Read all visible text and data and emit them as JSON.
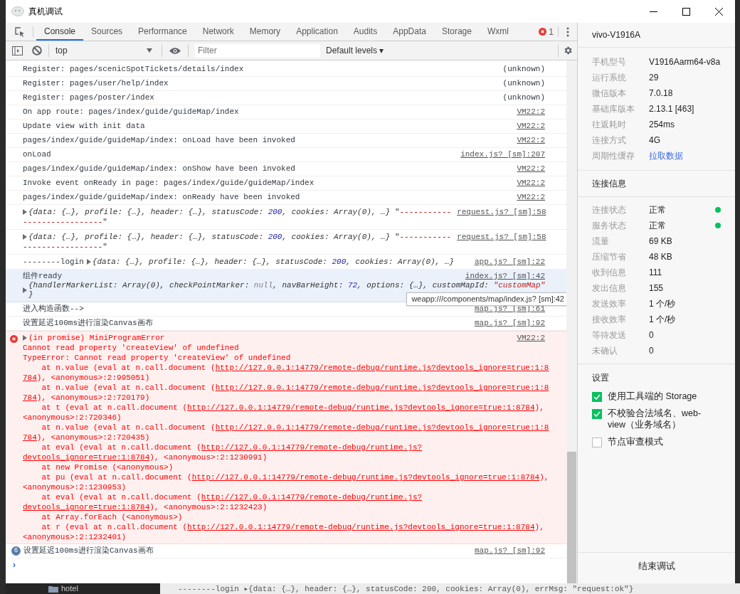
{
  "window": {
    "title": "真机调试"
  },
  "tabs": [
    {
      "label": "Console",
      "selected": true
    },
    {
      "label": "Sources",
      "selected": false
    },
    {
      "label": "Performance",
      "selected": false
    },
    {
      "label": "Network",
      "selected": false
    },
    {
      "label": "Memory",
      "selected": false
    },
    {
      "label": "Application",
      "selected": false
    },
    {
      "label": "Audits",
      "selected": false
    },
    {
      "label": "AppData",
      "selected": false
    },
    {
      "label": "Storage",
      "selected": false
    },
    {
      "label": "Wxml",
      "selected": false
    }
  ],
  "error_count": "1",
  "toolbar": {
    "context": "top",
    "filter_placeholder": "Filter",
    "levels": "Default levels",
    "levels_caret": "▾"
  },
  "console": [
    {
      "kind": "log",
      "text": "Register: pages/scenicSpotTickets/details/index",
      "source": "(unknown)",
      "source_link": false
    },
    {
      "kind": "log",
      "text": "Register: pages/user/help/index",
      "source": "(unknown)",
      "source_link": false
    },
    {
      "kind": "log",
      "text": "Register: pages/poster/index",
      "source": "(unknown)",
      "source_link": false
    },
    {
      "kind": "log",
      "text": "On app route: pages/index/guide/guideMap/index",
      "source": "VM22:2",
      "source_link": true
    },
    {
      "kind": "log",
      "text": "Update view with init data",
      "source": "VM22:2",
      "source_link": true
    },
    {
      "kind": "log",
      "text": "pages/index/guide/guideMap/index: onLoad have been invoked",
      "source": "VM22:2",
      "source_link": true
    },
    {
      "kind": "log",
      "text": "onLoad",
      "source": "index.js? [sm]:207",
      "source_link": true
    },
    {
      "kind": "log",
      "text": "pages/index/guide/guideMap/index: onShow have been invoked",
      "source": "VM22:2",
      "source_link": true
    },
    {
      "kind": "log",
      "text": "Invoke event onReady in page: pages/index/guide/guideMap/index",
      "source": "VM22:2",
      "source_link": true
    },
    {
      "kind": "log",
      "text": "pages/index/guide/guideMap/index: onReady have been invoked",
      "source": "VM22:2",
      "source_link": true
    },
    {
      "kind": "object",
      "lines": [
        [
          {
            "text": "{data: {…}, profile: {…}, header: {…}, statusCode: ",
            "kind": "obj"
          },
          {
            "text": "200",
            "kind": "num"
          },
          {
            "text": ", cookies: Array(0), …}",
            "kind": "obj"
          },
          {
            "text": " \"",
            "kind": "plain"
          },
          {
            "text": "-----------",
            "kind": "str"
          }
        ],
        [
          {
            "text": "-----------------",
            "kind": "str"
          },
          {
            "text": "\"",
            "kind": "plain"
          }
        ]
      ],
      "source": "request.js? [sm]:58"
    },
    {
      "kind": "object",
      "lines": [
        [
          {
            "text": "{data: {…}, profile: {…}, header: {…}, statusCode: ",
            "kind": "obj"
          },
          {
            "text": "200",
            "kind": "num"
          },
          {
            "text": ", cookies: Array(0), …}",
            "kind": "obj"
          },
          {
            "text": " \"",
            "kind": "plain"
          },
          {
            "text": "-----------",
            "kind": "str"
          }
        ],
        [
          {
            "text": "-----------------",
            "kind": "str"
          },
          {
            "text": "\"",
            "kind": "plain"
          }
        ]
      ],
      "source": "request.js? [sm]:58"
    },
    {
      "kind": "object",
      "prefix": "--------login",
      "lines": [
        [
          {
            "text": "{data: {…}, profile: {…}, header: {…}, statusCode: ",
            "kind": "obj"
          },
          {
            "text": "200",
            "kind": "num"
          },
          {
            "text": ", cookies: Array(0), …}",
            "kind": "obj"
          }
        ]
      ],
      "source": "app.js? [sm]:22"
    },
    {
      "kind": "group",
      "text": "组件ready",
      "lines": [
        [
          {
            "text": "{handlerMarkerList: Array(0), checkPointMarker: ",
            "kind": "obj"
          },
          {
            "text": "null",
            "kind": "null"
          },
          {
            "text": ", navBarHeight: ",
            "kind": "obj"
          },
          {
            "text": "72",
            "kind": "num"
          },
          {
            "text": ", options: {…}, customMapId: ",
            "kind": "obj"
          },
          {
            "text": "\"customMap\"",
            "kind": "str"
          }
        ],
        [
          {
            "text": "}",
            "kind": "obj"
          }
        ]
      ],
      "source": "index.js? [sm]:42",
      "tooltip": "weapp:///components/map/index.js? [sm]:42"
    },
    {
      "kind": "log",
      "text": "进入构造函数-->",
      "source": "map.js? [sm]:61",
      "source_link": true
    },
    {
      "kind": "log",
      "text": "设置延迟100ms进行渲染Canvas画布",
      "source": "map.js? [sm]:92",
      "source_link": true
    },
    {
      "kind": "error",
      "head": "(in promise) MiniProgramError",
      "source": "VM22:2",
      "lines": [
        [
          {
            "text": "Cannot read property 'createView' of undefined",
            "kind": "text"
          }
        ],
        [
          {
            "text": "TypeError: Cannot read property 'createView' of undefined",
            "kind": "text"
          }
        ],
        [
          {
            "text": "    at n.value (eval at n.call.document (",
            "kind": "text"
          },
          {
            "text": "http://127.0.0.1:14779/remote-debug/runtime.js?devtools_ignore=true:1:8",
            "kind": "link"
          }
        ],
        [
          {
            "text": "784",
            "kind": "link"
          },
          {
            "text": "), <anonymous>:2:995051)",
            "kind": "text"
          }
        ],
        [
          {
            "text": "    at n.value (eval at n.call.document (",
            "kind": "text"
          },
          {
            "text": "http://127.0.0.1:14779/remote-debug/runtime.js?devtools_ignore=true:1:8",
            "kind": "link"
          }
        ],
        [
          {
            "text": "784",
            "kind": "link"
          },
          {
            "text": "), <anonymous>:2:720179)",
            "kind": "text"
          }
        ],
        [
          {
            "text": "    at t (eval at n.call.document (",
            "kind": "text"
          },
          {
            "text": "http://127.0.0.1:14779/remote-debug/runtime.js?devtools_ignore=true:1:8784",
            "kind": "link"
          },
          {
            "text": "),",
            "kind": "text"
          }
        ],
        [
          {
            "text": "<anonymous>:2:720346)",
            "kind": "text"
          }
        ],
        [
          {
            "text": "    at n.value (eval at n.call.document (",
            "kind": "text"
          },
          {
            "text": "http://127.0.0.1:14779/remote-debug/runtime.js?devtools_ignore=true:1:8",
            "kind": "link"
          }
        ],
        [
          {
            "text": "784",
            "kind": "link"
          },
          {
            "text": "), <anonymous>:2:720435)",
            "kind": "text"
          }
        ],
        [
          {
            "text": "    at eval (eval at n.call.document (",
            "kind": "text"
          },
          {
            "text": "http://127.0.0.1:14779/remote-debug/runtime.js?",
            "kind": "link"
          }
        ],
        [
          {
            "text": "devtools_ignore=true:1:8784",
            "kind": "link"
          },
          {
            "text": "), <anonymous>:2:1230991)",
            "kind": "text"
          }
        ],
        [
          {
            "text": "    at new Promise (<anonymous>)",
            "kind": "text"
          }
        ],
        [
          {
            "text": "    at pu (eval at n.call.document (",
            "kind": "text"
          },
          {
            "text": "http://127.0.0.1:14779/remote-debug/runtime.js?devtools_ignore=true:1:8784",
            "kind": "link"
          },
          {
            "text": "),",
            "kind": "text"
          }
        ],
        [
          {
            "text": "<anonymous>:2:1230953)",
            "kind": "text"
          }
        ],
        [
          {
            "text": "    at eval (eval at n.call.document (",
            "kind": "text"
          },
          {
            "text": "http://127.0.0.1:14779/remote-debug/runtime.js?",
            "kind": "link"
          }
        ],
        [
          {
            "text": "devtools_ignore=true:1:8784",
            "kind": "link"
          },
          {
            "text": "), <anonymous>:2:1232423)",
            "kind": "text"
          }
        ],
        [
          {
            "text": "    at Array.forEach (<anonymous>)",
            "kind": "text"
          }
        ],
        [
          {
            "text": "    at r (eval at n.call.document (",
            "kind": "text"
          },
          {
            "text": "http://127.0.0.1:14779/remote-debug/runtime.js?devtools_ignore=true:1:8784",
            "kind": "link"
          },
          {
            "text": "),",
            "kind": "text"
          }
        ],
        [
          {
            "text": "<anonymous>:2:1232401)",
            "kind": "text"
          }
        ]
      ]
    },
    {
      "kind": "repeat",
      "count": "6",
      "text": "设置延迟100ms进行渲染Canvas画布",
      "source": "map.js? [sm]:92"
    }
  ],
  "prompt": "›",
  "device": {
    "name": "vivo-V1916A",
    "info": [
      {
        "label": "手机型号",
        "value": "V1916Aarm64-v8a",
        "kind": "text"
      },
      {
        "label": "运行系统",
        "value": "29",
        "kind": "text"
      },
      {
        "label": "微信版本",
        "value": "7.0.18",
        "kind": "text"
      },
      {
        "label": "基础库版本",
        "value": "2.13.1 [463]",
        "kind": "text"
      },
      {
        "label": "往返耗时",
        "value": "254ms",
        "kind": "text"
      },
      {
        "label": "连接方式",
        "value": "4G",
        "kind": "text"
      },
      {
        "label": "周期性缓存",
        "value": "拉取数据",
        "kind": "link"
      }
    ]
  },
  "connection": {
    "title": "连接信息",
    "rows": [
      {
        "label": "连接状态",
        "value": "正常",
        "color": "#07c160"
      },
      {
        "label": "服务状态",
        "value": "正常",
        "color": "#07c160"
      },
      {
        "label": "流量",
        "value": "69 KB"
      },
      {
        "label": "压缩节省",
        "value": "48 KB"
      },
      {
        "label": "收到信息",
        "value": "111"
      },
      {
        "label": "发出信息",
        "value": "155"
      },
      {
        "label": "发送效率",
        "value": "1 个/秒"
      },
      {
        "label": "接收效率",
        "value": "1 个/秒"
      },
      {
        "label": "等待发送",
        "value": "0"
      },
      {
        "label": "未确认",
        "value": "0"
      }
    ]
  },
  "settings": {
    "title": "设置",
    "options": [
      {
        "label": "使用工具端的 Storage",
        "checked": true
      },
      {
        "label": "不校验合法域名、web-view（业务域名）",
        "checked": true
      },
      {
        "label": "节点审查模式",
        "checked": false
      }
    ]
  },
  "end_button": "结束调试",
  "background": {
    "folder": "hotel",
    "console_line": "--------login ▸{data: {…}, header: {…}, statusCode: 200, cookies: Array(0), errMsg: \"request:ok\"}"
  }
}
